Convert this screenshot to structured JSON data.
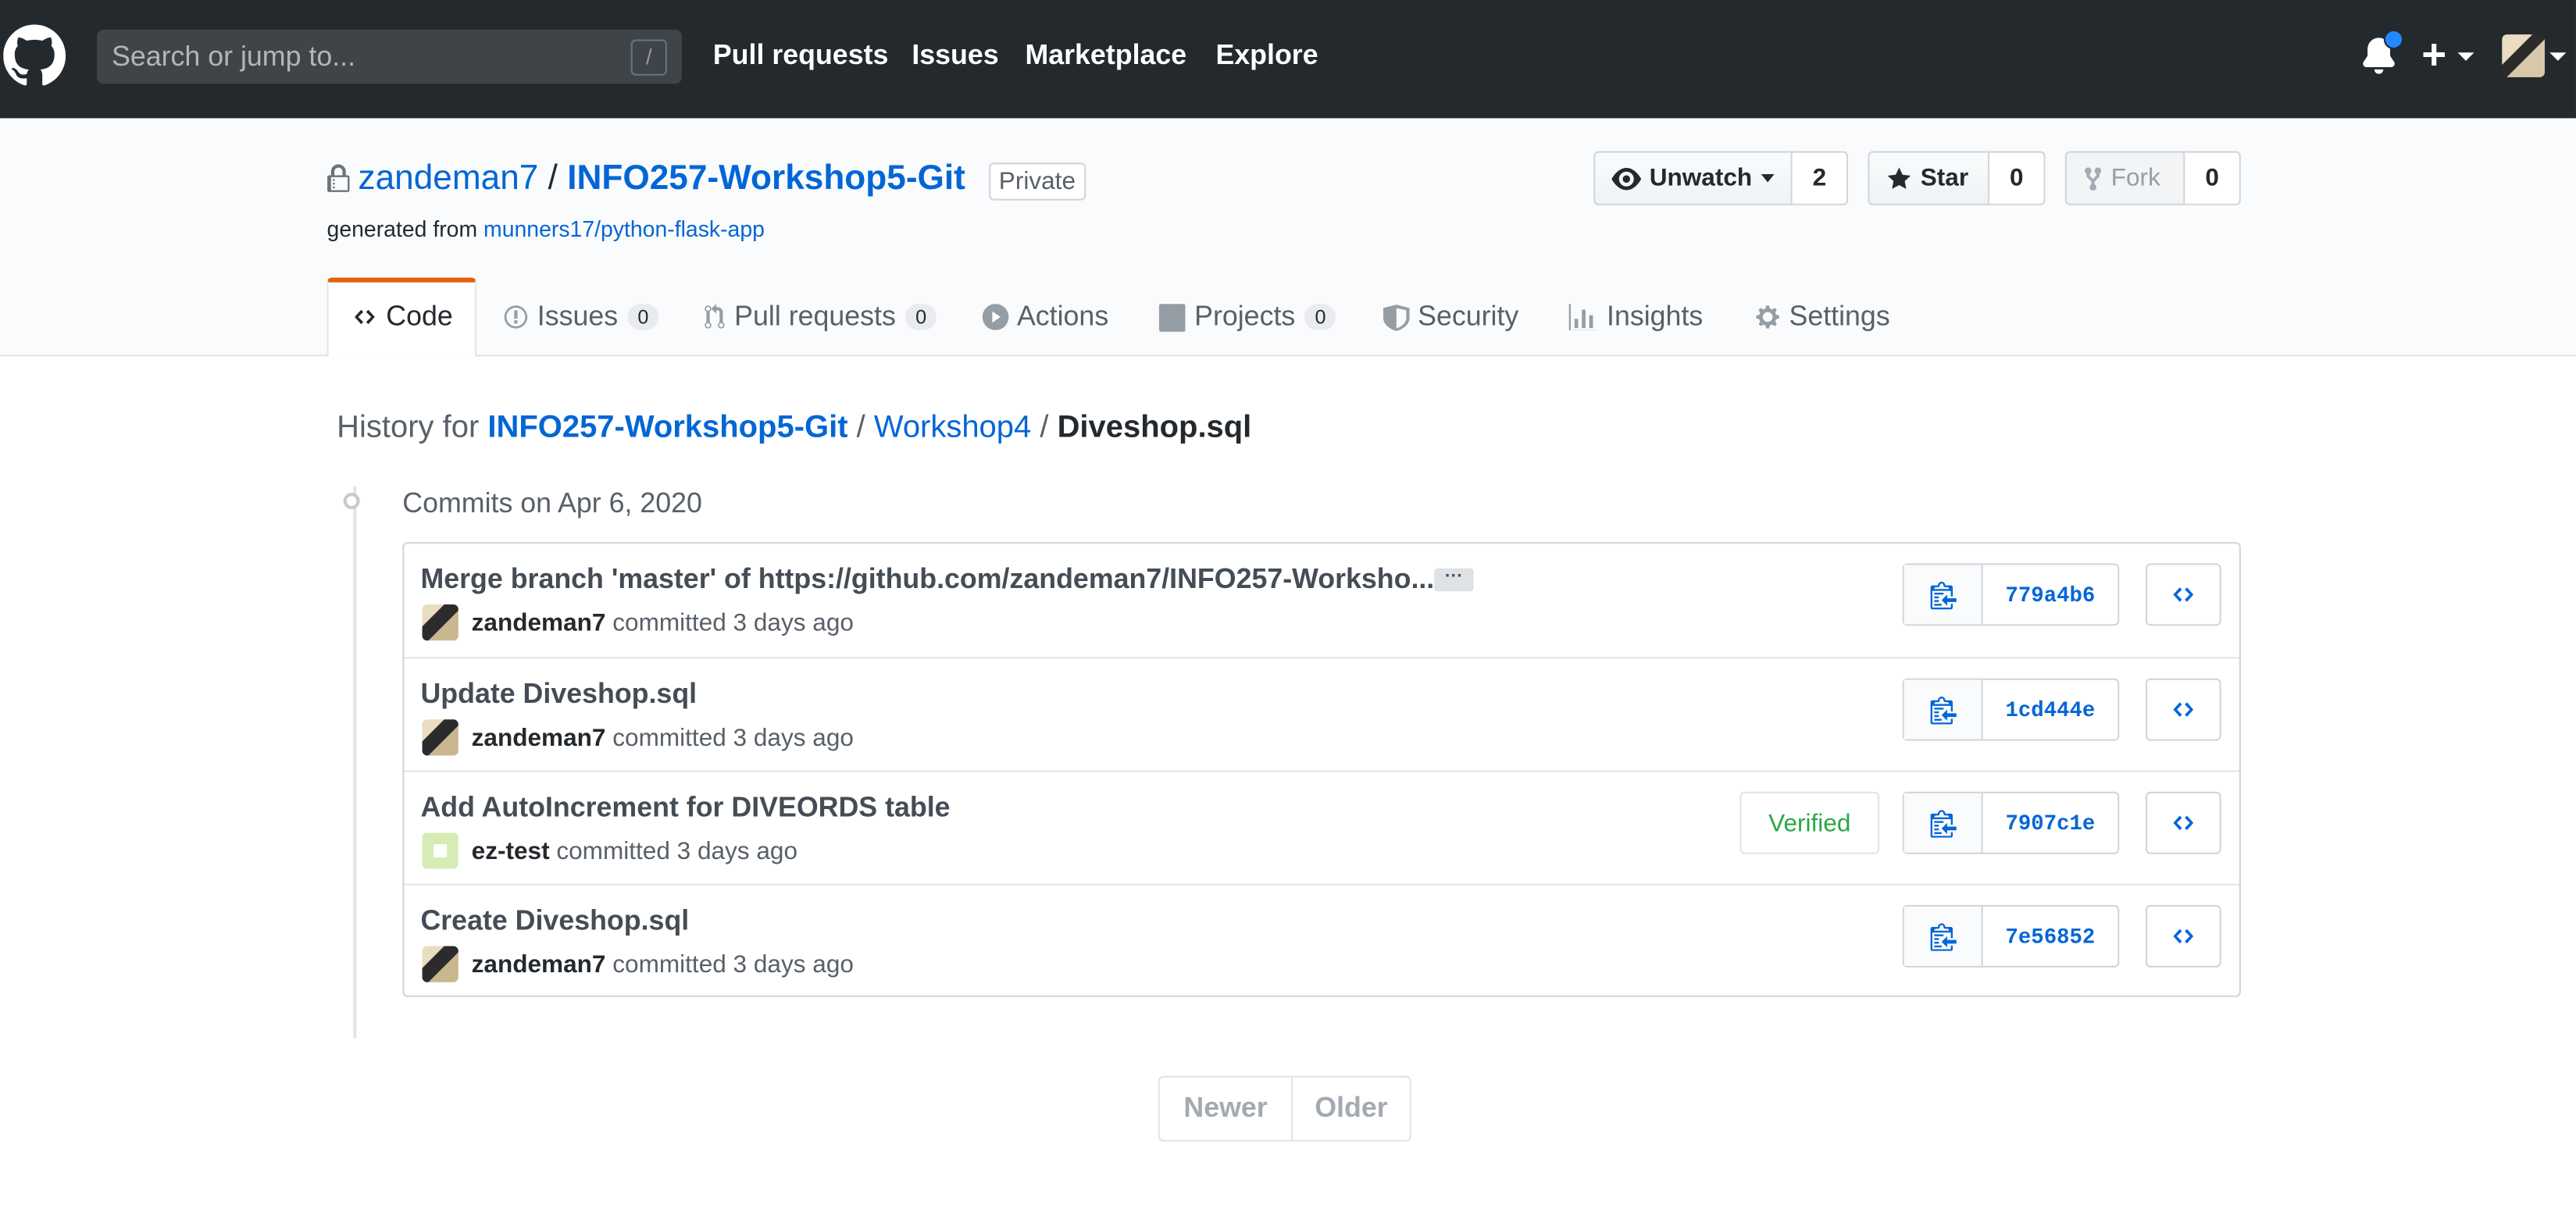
{
  "header": {
    "search_placeholder": "Search or jump to...",
    "search_shortcut": "/",
    "nav": [
      "Pull requests",
      "Issues",
      "Marketplace",
      "Explore"
    ],
    "plus_icon": "+"
  },
  "repo": {
    "owner": "zandeman7",
    "separator": "/",
    "name": "INFO257-Workshop5-Git",
    "visibility": "Private",
    "generated_prefix": "generated from",
    "template": "munners17/python-flask-app",
    "watch_label": "Unwatch",
    "watch_count": "2",
    "star_label": "Star",
    "star_count": "0",
    "fork_label": "Fork",
    "fork_count": "0"
  },
  "tabs": [
    {
      "label": "Code"
    },
    {
      "label": "Issues",
      "count": "0"
    },
    {
      "label": "Pull requests",
      "count": "0"
    },
    {
      "label": "Actions"
    },
    {
      "label": "Projects",
      "count": "0"
    },
    {
      "label": "Security"
    },
    {
      "label": "Insights"
    },
    {
      "label": "Settings"
    }
  ],
  "history": {
    "prefix": "History for",
    "repo": "INFO257-Workshop5-Git",
    "folder": "Workshop4",
    "file": "Diveshop.sql",
    "sep": "/"
  },
  "commits_date": "Commits on Apr 6, 2020",
  "commits": [
    {
      "message": "Merge branch 'master' of https://github.com/zandeman7/INFO257-Worksho...",
      "author": "zandeman7",
      "action": "committed 3 days ago",
      "sha": "779a4b6",
      "verified": ""
    },
    {
      "message": "Update Diveshop.sql",
      "author": "zandeman7",
      "action": "committed 3 days ago",
      "sha": "1cd444e",
      "verified": ""
    },
    {
      "message": "Add AutoIncrement for DIVEORDS table",
      "author": "ez-test",
      "action": "committed 3 days ago",
      "sha": "7907c1e",
      "verified": "Verified"
    },
    {
      "message": "Create Diveshop.sql",
      "author": "zandeman7",
      "action": "committed 3 days ago",
      "sha": "7e56852",
      "verified": ""
    }
  ],
  "ellipsis": "···",
  "pagination": {
    "newer": "Newer",
    "older": "Older"
  },
  "colors": {
    "header_bg": "#24292e",
    "link": "#0366d6",
    "active_tab": "#e36209",
    "verified": "#28a745"
  }
}
